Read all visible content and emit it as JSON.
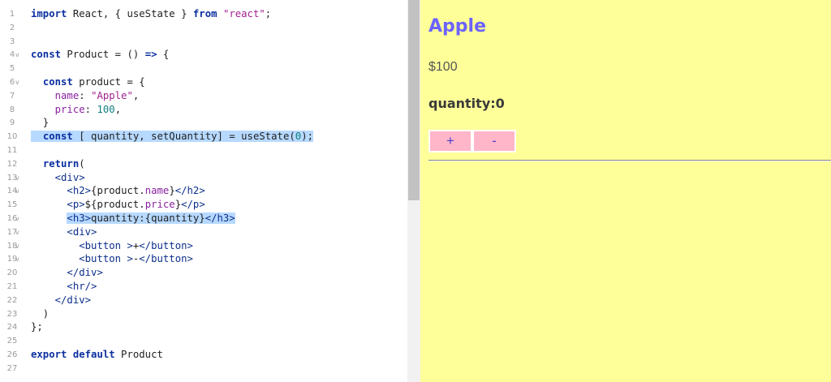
{
  "editor": {
    "lines": [
      {
        "n": "1",
        "fold": "",
        "parts": [
          {
            "t": "import",
            "c": "kw"
          },
          {
            "t": " React, { useState } "
          },
          {
            "t": "from",
            "c": "kw"
          },
          {
            "t": " "
          },
          {
            "t": "\"react\"",
            "c": "str"
          },
          {
            "t": ";"
          }
        ]
      },
      {
        "n": "2",
        "fold": "",
        "parts": []
      },
      {
        "n": "3",
        "fold": "",
        "parts": []
      },
      {
        "n": "4",
        "fold": "v",
        "parts": [
          {
            "t": "const",
            "c": "kw"
          },
          {
            "t": " Product = () "
          },
          {
            "t": "=>",
            "c": "kw"
          },
          {
            "t": " {"
          }
        ]
      },
      {
        "n": "5",
        "fold": "",
        "parts": []
      },
      {
        "n": "6",
        "fold": "v",
        "parts": [
          {
            "t": "  "
          },
          {
            "t": "const",
            "c": "kw"
          },
          {
            "t": " product = {"
          }
        ]
      },
      {
        "n": "7",
        "fold": "",
        "parts": [
          {
            "t": "    "
          },
          {
            "t": "name",
            "c": "prop"
          },
          {
            "t": ": "
          },
          {
            "t": "\"Apple\"",
            "c": "str"
          },
          {
            "t": ","
          }
        ]
      },
      {
        "n": "8",
        "fold": "",
        "parts": [
          {
            "t": "    "
          },
          {
            "t": "price",
            "c": "prop"
          },
          {
            "t": ": "
          },
          {
            "t": "100",
            "c": "num"
          },
          {
            "t": ","
          }
        ]
      },
      {
        "n": "9",
        "fold": "",
        "parts": [
          {
            "t": "  }"
          }
        ]
      },
      {
        "n": "10",
        "fold": "",
        "hl": true,
        "parts": [
          {
            "t": "  "
          },
          {
            "t": "const",
            "c": "kw"
          },
          {
            "t": " [ quantity, setQuantity] = useState("
          },
          {
            "t": "0",
            "c": "num"
          },
          {
            "t": ");"
          }
        ]
      },
      {
        "n": "11",
        "fold": "",
        "parts": []
      },
      {
        "n": "12",
        "fold": "",
        "parts": [
          {
            "t": "  "
          },
          {
            "t": "return",
            "c": "kw"
          },
          {
            "t": "("
          }
        ]
      },
      {
        "n": "13",
        "fold": "v",
        "parts": [
          {
            "t": "    "
          },
          {
            "t": "<div>",
            "c": "tag"
          }
        ]
      },
      {
        "n": "14",
        "fold": "v",
        "parts": [
          {
            "t": "      "
          },
          {
            "t": "<h2>",
            "c": "tag"
          },
          {
            "t": "{product."
          },
          {
            "t": "name",
            "c": "prop"
          },
          {
            "t": "}"
          },
          {
            "t": "</h2>",
            "c": "tag"
          }
        ]
      },
      {
        "n": "15",
        "fold": "",
        "parts": [
          {
            "t": "      "
          },
          {
            "t": "<p>",
            "c": "tag"
          },
          {
            "t": "${product."
          },
          {
            "t": "price",
            "c": "prop"
          },
          {
            "t": "}"
          },
          {
            "t": "</p>",
            "c": "tag"
          }
        ]
      },
      {
        "n": "16",
        "fold": "v",
        "hlInline": true,
        "parts": [
          {
            "t": "      "
          },
          {
            "t": "<h3>",
            "c": "tag hl"
          },
          {
            "t": "quantity:{quantity}",
            "c": "hl"
          },
          {
            "t": "</h3>",
            "c": "tag hl"
          }
        ]
      },
      {
        "n": "17",
        "fold": "v",
        "parts": [
          {
            "t": "      "
          },
          {
            "t": "<div>",
            "c": "tag"
          }
        ]
      },
      {
        "n": "18",
        "fold": "v",
        "parts": [
          {
            "t": "        "
          },
          {
            "t": "<button >",
            "c": "tag"
          },
          {
            "t": "+"
          },
          {
            "t": "</button>",
            "c": "tag"
          }
        ]
      },
      {
        "n": "19",
        "fold": "v",
        "parts": [
          {
            "t": "        "
          },
          {
            "t": "<button >",
            "c": "tag"
          },
          {
            "t": "-"
          },
          {
            "t": "</button>",
            "c": "tag"
          }
        ]
      },
      {
        "n": "20",
        "fold": "",
        "parts": [
          {
            "t": "      "
          },
          {
            "t": "</div>",
            "c": "tag"
          }
        ]
      },
      {
        "n": "21",
        "fold": "",
        "parts": [
          {
            "t": "      "
          },
          {
            "t": "<hr/>",
            "c": "tag"
          }
        ]
      },
      {
        "n": "22",
        "fold": "",
        "parts": [
          {
            "t": "    "
          },
          {
            "t": "</div>",
            "c": "tag"
          }
        ]
      },
      {
        "n": "23",
        "fold": "",
        "parts": [
          {
            "t": "  )"
          }
        ]
      },
      {
        "n": "24",
        "fold": "",
        "parts": [
          {
            "t": "};"
          }
        ]
      },
      {
        "n": "25",
        "fold": "",
        "parts": []
      },
      {
        "n": "26",
        "fold": "",
        "parts": [
          {
            "t": "export",
            "c": "kw"
          },
          {
            "t": " "
          },
          {
            "t": "default",
            "c": "kw"
          },
          {
            "t": " Product"
          }
        ]
      },
      {
        "n": "27",
        "fold": "",
        "parts": []
      }
    ]
  },
  "preview": {
    "title": "Apple",
    "price": "$100",
    "quantity": "quantity:0",
    "plus_label": "+",
    "minus_label": "-",
    "background": "#ffff99",
    "title_color": "#6c63ff",
    "button_color": "#ffb6c8"
  }
}
